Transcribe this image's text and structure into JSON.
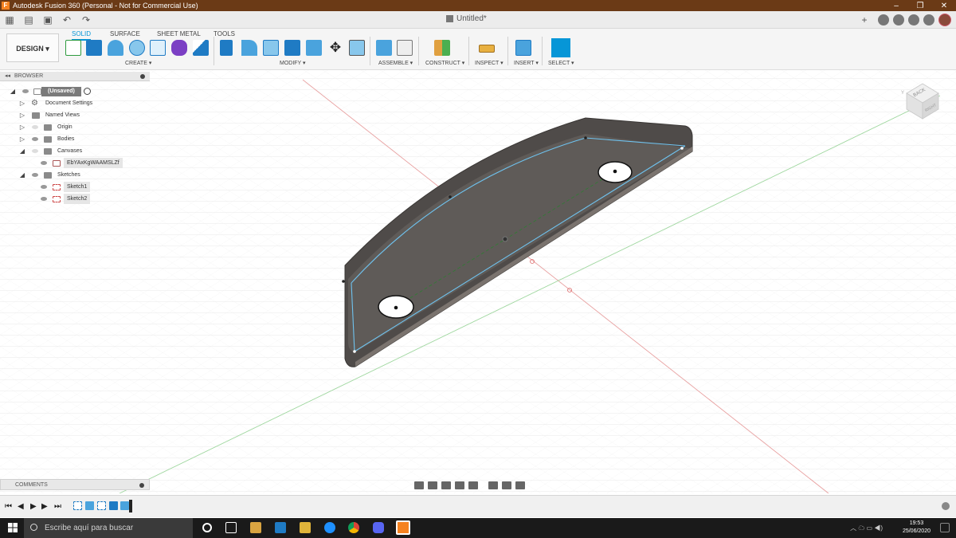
{
  "window": {
    "title": "Autodesk Fusion 360 (Personal - Not for Commercial Use)",
    "minimize": "–",
    "maximize": "❐",
    "close": "✕"
  },
  "doc_tab": {
    "title": "Untitled*"
  },
  "ribbon": {
    "workspace": "DESIGN ▾",
    "tabs": [
      "SOLID",
      "SURFACE",
      "SHEET METAL",
      "TOOLS"
    ],
    "groups": [
      "CREATE ▾",
      "MODIFY ▾",
      "ASSEMBLE ▾",
      "CONSTRUCT ▾",
      "INSPECT ▾",
      "INSERT ▾",
      "SELECT ▾"
    ]
  },
  "browser": {
    "header": "BROWSER",
    "items": [
      {
        "label": "(Unsaved)"
      },
      {
        "label": "Document Settings"
      },
      {
        "label": "Named Views"
      },
      {
        "label": "Origin"
      },
      {
        "label": "Bodies"
      },
      {
        "label": "Canvases"
      },
      {
        "label": "EbYAxKgWAAMSLZf"
      },
      {
        "label": "Sketches"
      },
      {
        "label": "Sketch1"
      },
      {
        "label": "Sketch2"
      }
    ]
  },
  "comments": {
    "header": "COMMENTS"
  },
  "viewcube": {
    "face": "BACK",
    "side": "RIGHT",
    "axis_y": "Y"
  },
  "taskbar": {
    "search_placeholder": "Escribe aquí para buscar",
    "time": "19:53",
    "date": "25/06/2020"
  },
  "colors": {
    "titlebar": "#6b3a16",
    "accent": "#0696d7",
    "part_body": "#5f5b58",
    "part_edge": "#6fc3ef"
  }
}
